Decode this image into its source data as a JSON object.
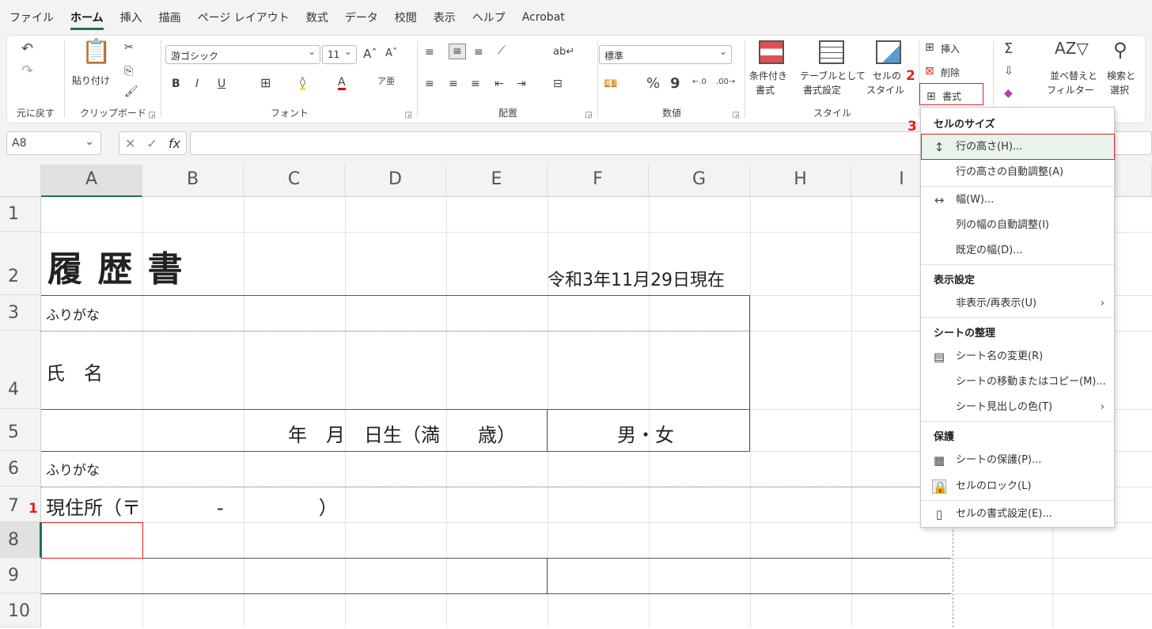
{
  "tabs": [
    "ファイル",
    "ホーム",
    "挿入",
    "描画",
    "ページ レイアウト",
    "数式",
    "データ",
    "校閲",
    "表示",
    "ヘルプ",
    "Acrobat"
  ],
  "ribbon": {
    "undo_label": "元に戻す",
    "clipboard": {
      "paste": "貼り付け",
      "group": "クリップボード"
    },
    "font": {
      "name": "游ゴシック",
      "size": "11",
      "group": "フォント"
    },
    "align": {
      "group": "配置"
    },
    "number": {
      "format": "標準",
      "group": "数値",
      "percent": "%",
      "comma": "9"
    },
    "styles": {
      "cond": "条件付き",
      "cond2": "書式",
      "table": "テーブルとして",
      "table2": "書式設定",
      "cell": "セルの",
      "cell2": "スタイル",
      "group": "スタイル"
    },
    "cells": {
      "insert": "挿入",
      "delete": "削除",
      "format": "書式"
    },
    "editing": {
      "sort": "並べ替えと",
      "sort2": "フィルター",
      "find": "検索と",
      "find2": "選択"
    }
  },
  "formula_bar": {
    "name_box": "A8",
    "fx": "fx"
  },
  "sheet": {
    "columns": [
      "A",
      "B",
      "C",
      "D",
      "E",
      "F",
      "G",
      "H",
      "I"
    ],
    "rows": [
      "1",
      "2",
      "3",
      "4",
      "5",
      "6",
      "7",
      "8",
      "9",
      "10"
    ],
    "cells": {
      "title": "履 歴 書",
      "date": "令和3年11月29日現在",
      "furigana1": "ふりがな",
      "name": "氏　名",
      "birth": "年　月　日生（満　　歳）",
      "gender": "男・女",
      "furigana2": "ふりがな",
      "address": "現住所（〒　　　　-　　　　　）"
    }
  },
  "menu": {
    "sec1": "セルのサイズ",
    "row_height": "行の高さ(H)...",
    "row_auto": "行の高さの自動調整(A)",
    "width": "幅(W)...",
    "col_auto": "列の幅の自動調整(I)",
    "default_width": "既定の幅(D)...",
    "sec2": "表示設定",
    "hide": "非表示/再表示(U)",
    "sec3": "シートの整理",
    "rename": "シート名の変更(R)",
    "move": "シートの移動またはコピー(M)...",
    "tab_color": "シート見出しの色(T)",
    "sec4": "保護",
    "protect": "シートの保護(P)...",
    "lock": "セルのロック(L)",
    "format_cells": "セルの書式設定(E)..."
  },
  "annotations": [
    "1",
    "2",
    "3"
  ]
}
